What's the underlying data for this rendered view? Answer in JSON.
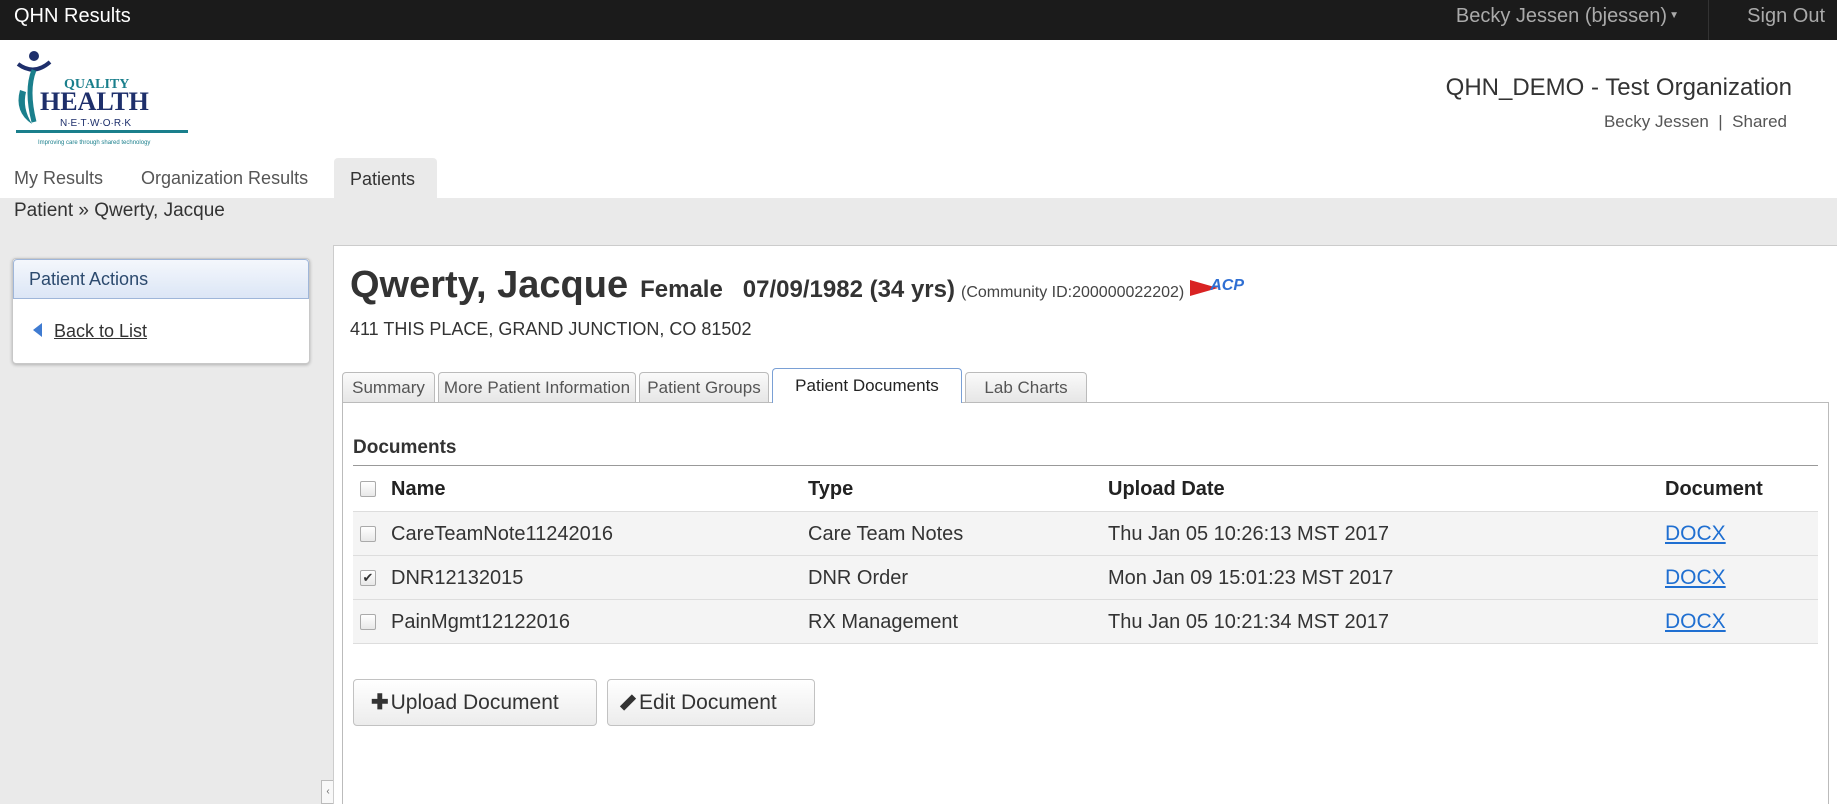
{
  "topbar": {
    "app_title": "QHN Results",
    "user_menu": "Becky Jessen (bjessen)",
    "sign_out": "Sign Out"
  },
  "logo": {
    "line1": "QUALITY",
    "line2": "HEALTH",
    "line3": "N·E·T·W·O·R·K",
    "tagline": "Improving care through shared technology"
  },
  "org": {
    "name": "QHN_DEMO - Test Organization",
    "user": "Becky Jessen",
    "mode": "Shared"
  },
  "nav": {
    "my_results": "My Results",
    "org_results": "Organization Results",
    "patients": "Patients"
  },
  "breadcrumb": "Patient » Qwerty, Jacque",
  "side": {
    "title": "Patient Actions",
    "back": "Back to List"
  },
  "patient": {
    "name": "Qwerty, Jacque",
    "meta": "Female   07/09/1982 (34 yrs)",
    "community_id": "(Community ID:200000022202)",
    "badge": "ACP",
    "address": "411 THIS PLACE, GRAND JUNCTION, CO 81502"
  },
  "tabs": [
    "Summary",
    "More Patient Information",
    "Patient Groups",
    "Patient Documents",
    "Lab Charts"
  ],
  "active_tab": "Patient Documents",
  "documents": {
    "title": "Documents",
    "columns": {
      "name": "Name",
      "type": "Type",
      "upload_date": "Upload Date",
      "document": "Document"
    },
    "rows": [
      {
        "name": "CareTeamNote11242016",
        "type": "Care Team Notes",
        "date": "Thu Jan 05 10:26:13 MST 2017",
        "doc": "DOCX",
        "checked": false
      },
      {
        "name": "DNR12132015",
        "type": "DNR Order",
        "date": "Mon Jan 09 15:01:23 MST 2017",
        "doc": "DOCX",
        "checked": true
      },
      {
        "name": "PainMgmt12122016",
        "type": "RX Management",
        "date": "Thu Jan 05 10:21:34 MST 2017",
        "doc": "DOCX",
        "checked": false
      }
    ],
    "upload_btn": "Upload Document",
    "edit_btn": "Edit Document"
  },
  "colors": {
    "topbar": "#1b1b1b",
    "link": "#1f6fd1",
    "logo_teal": "#1a7f8c",
    "logo_navy": "#1e2f6b"
  }
}
